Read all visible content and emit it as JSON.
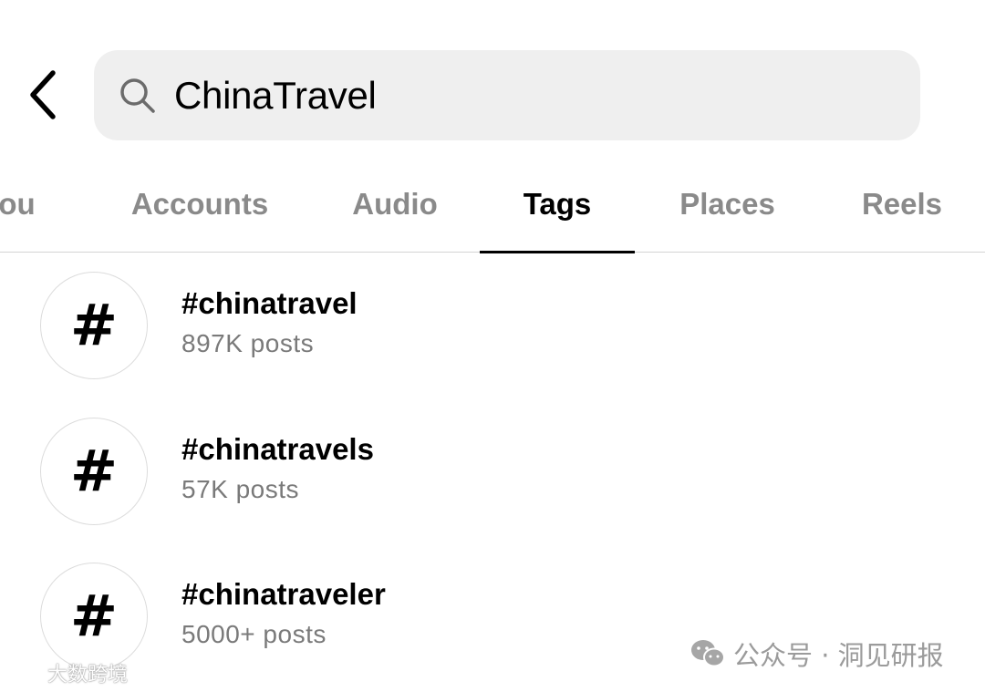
{
  "search": {
    "value": "ChinaTravel"
  },
  "tabs": [
    {
      "label": "you",
      "active": false
    },
    {
      "label": "Accounts",
      "active": false
    },
    {
      "label": "Audio",
      "active": false
    },
    {
      "label": "Tags",
      "active": true
    },
    {
      "label": "Places",
      "active": false
    },
    {
      "label": "Reels",
      "active": false
    }
  ],
  "results": [
    {
      "icon": "hashtag-icon",
      "glyph": "#",
      "name": "#chinatravel",
      "count": "897K posts"
    },
    {
      "icon": "hashtag-icon",
      "glyph": "#",
      "name": "#chinatravels",
      "count": "57K posts"
    },
    {
      "icon": "hashtag-icon",
      "glyph": "#",
      "name": "#chinatraveler",
      "count": "5000+ posts"
    }
  ],
  "watermarks": {
    "left": "大数跨境",
    "right": "公众号 · 洞见研报"
  },
  "icons": {
    "back": "chevron-left-icon",
    "search": "search-icon"
  }
}
